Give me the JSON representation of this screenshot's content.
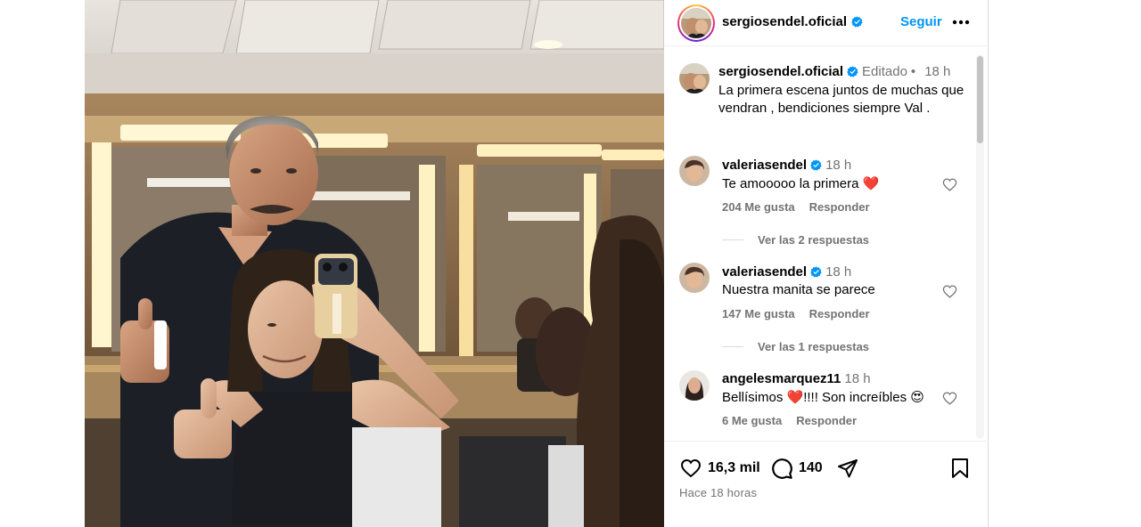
{
  "post": {
    "author": "sergiosendel.oficial",
    "follow_label": "Seguir",
    "caption": {
      "username": "sergiosendel.oficial",
      "edited": "Editado",
      "separator": "•",
      "time": "18 h",
      "text": "La primera escena juntos de muchas que vendran , bendiciones siempre Val ."
    },
    "likes": "16,3 mil",
    "comment_count": "140",
    "posted_ago": "Hace 18 horas"
  },
  "comments": [
    {
      "username": "valeriasendel",
      "time": "18 h",
      "text": "Te amooooo la primera ❤️",
      "likes": "204 Me gusta",
      "reply_label": "Responder",
      "replies": "Ver las 2 respuestas"
    },
    {
      "username": "valeriasendel",
      "time": "18 h",
      "text": "Nuestra manita se parece",
      "likes": "147 Me gusta",
      "reply_label": "Responder",
      "replies": "Ver las 1 respuestas"
    },
    {
      "username": "angelesmarquez11",
      "time": "18 h",
      "text": "Bellísimos ❤️!!!! Son increíbles 😍",
      "likes": "6 Me gusta",
      "reply_label": "Responder"
    }
  ],
  "icons": {
    "verified": "verified-badge-icon",
    "more": "more-options-icon",
    "like": "heart-icon",
    "comment": "comment-icon",
    "share": "share-icon",
    "save": "bookmark-icon"
  },
  "colors": {
    "accent_blue": "#0095f6",
    "muted": "#737373",
    "verified": "#0095f6"
  }
}
